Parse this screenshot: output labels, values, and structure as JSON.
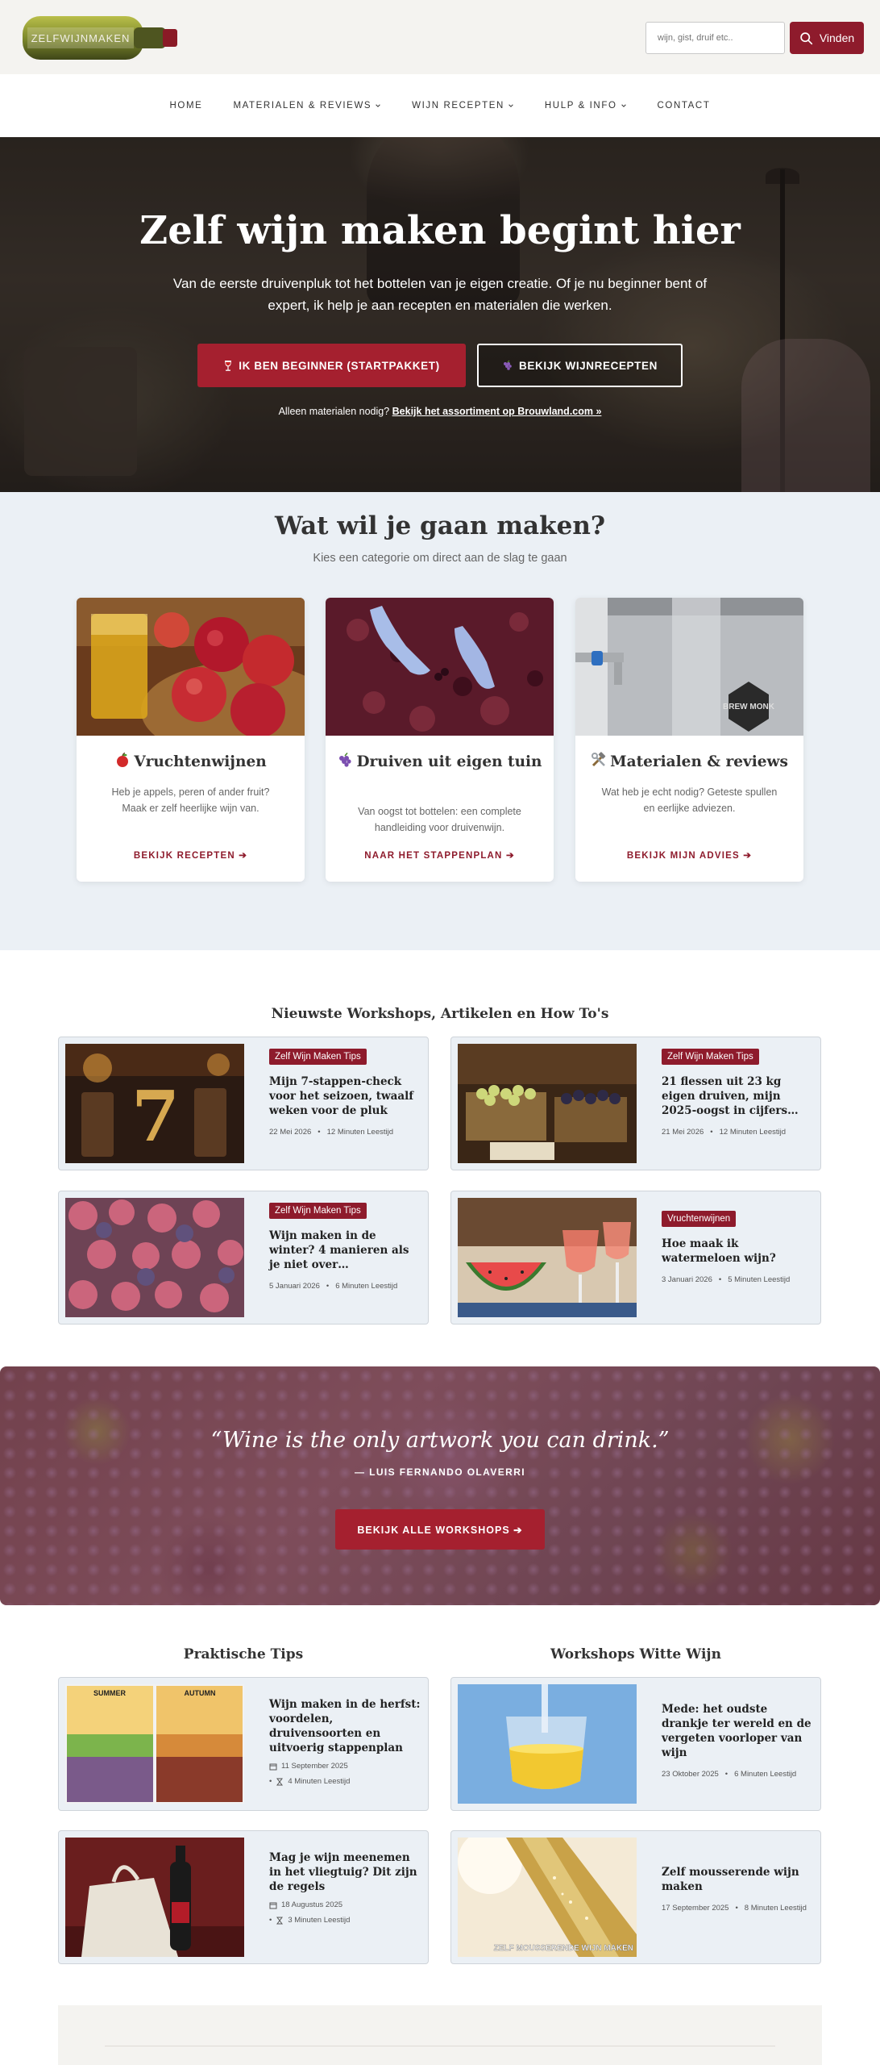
{
  "header": {
    "logo_text": "ZELFWIJNMAKEN",
    "search": {
      "placeholder": "wijn, gist, druif etc..",
      "button_label": "Vinden",
      "icon": "search-icon"
    }
  },
  "nav": {
    "items": [
      {
        "label": "HOME",
        "has_dropdown": false
      },
      {
        "label": "MATERIALEN & REVIEWS",
        "has_dropdown": true
      },
      {
        "label": "WIJN RECEPTEN",
        "has_dropdown": true
      },
      {
        "label": "HULP & INFO",
        "has_dropdown": true
      },
      {
        "label": "CONTACT",
        "has_dropdown": false
      }
    ]
  },
  "hero": {
    "title": "Zelf wijn maken begint hier",
    "subtitle": "Van de eerste druivenpluk tot het bottelen van je eigen creatie. Of je nu beginner bent of expert, ik help je aan recepten en materialen die werken.",
    "primary_button": "IK BEN BEGINNER (STARTPAKKET)",
    "secondary_button": "BEKIJK WIJNRECEPTEN",
    "note_prefix": "Alleen materialen nodig?",
    "note_link": "Bekijk het assortiment op Brouwland.com »"
  },
  "categories": {
    "title": "Wat wil je gaan maken?",
    "subtitle": "Kies een categorie om direct aan de slag te gaan",
    "cards": [
      {
        "title": "Vruchtenwijnen",
        "icon": "apple-icon",
        "text": "Heb je appels, peren of ander fruit? Maak er zelf heerlijke wijn van.",
        "link": "BEKIJK RECEPTEN ➔"
      },
      {
        "title": "Druiven uit eigen tuin",
        "icon": "grapes-icon",
        "text": "Van oogst tot bottelen: een complete handleiding voor druivenwijn.",
        "link": "NAAR HET STAPPENPLAN ➔"
      },
      {
        "title": "Materialen & reviews",
        "icon": "tools-icon",
        "text": "Wat heb je echt nodig? Geteste spullen en eerlijke adviezen.",
        "link": "BEKIJK MIJN ADVIES ➔"
      }
    ]
  },
  "latest": {
    "title": "Nieuwste Workshops, Artikelen en How To's",
    "posts": [
      {
        "badge": "Zelf Wijn Maken Tips",
        "title": "Mijn 7-stappen-check voor het seizoen, twaalf weken voor de pluk",
        "date": "22 Mei 2026",
        "read": "12 Minuten Leestijd"
      },
      {
        "badge": "Zelf Wijn Maken Tips",
        "title": "21 flessen uit 23 kg eigen druiven, mijn 2025-oogst in cijfers…",
        "date": "21 Mei 2026",
        "read": "12 Minuten Leestijd"
      },
      {
        "badge": "Zelf Wijn Maken Tips",
        "title": "Wijn maken in de winter? 4 manieren als je niet over…",
        "date": "5 Januari 2026",
        "read": "6 Minuten Leestijd"
      },
      {
        "badge": "Vruchtenwijnen",
        "title": "Hoe maak ik watermeloen wijn?",
        "date": "3 Januari 2026",
        "read": "5 Minuten Leestijd"
      }
    ]
  },
  "quote": {
    "text": "“Wine is the only artwork you can drink.”",
    "author": "— LUIS FERNANDO OLAVERRI",
    "button": "BEKIJK ALLE WORKSHOPS ➔"
  },
  "tips": {
    "title": "Praktische Tips",
    "posts": [
      {
        "title": "Wijn maken in de herfst: voordelen, druivensoorten en uitvoerig stappenplan",
        "date": "11 September 2025",
        "read": "4 Minuten Leestijd",
        "image_labels": [
          "SUMMER",
          "AUTUMN"
        ]
      },
      {
        "title": "Mag je wijn meenemen in het vliegtuig? Dit zijn de regels",
        "date": "18 Augustus 2025",
        "read": "3 Minuten Leestijd"
      }
    ]
  },
  "white": {
    "title": "Workshops Witte Wijn",
    "posts": [
      {
        "title": "Mede: het oudste drankje ter wereld en de vergeten voorloper van wijn",
        "date": "23 Oktober 2025",
        "read": "6 Minuten Leestijd"
      },
      {
        "title": "Zelf mousserende wijn maken",
        "date": "17 September 2025",
        "read": "8 Minuten Leestijd",
        "image_text": "ZELF MOUSSERENDE WIJN MAKEN"
      }
    ]
  },
  "colors": {
    "accent": "#8e1b2c",
    "button_red": "#a5202f",
    "section_bg": "#ebf0f5",
    "header_bg": "#f4f3f0"
  }
}
